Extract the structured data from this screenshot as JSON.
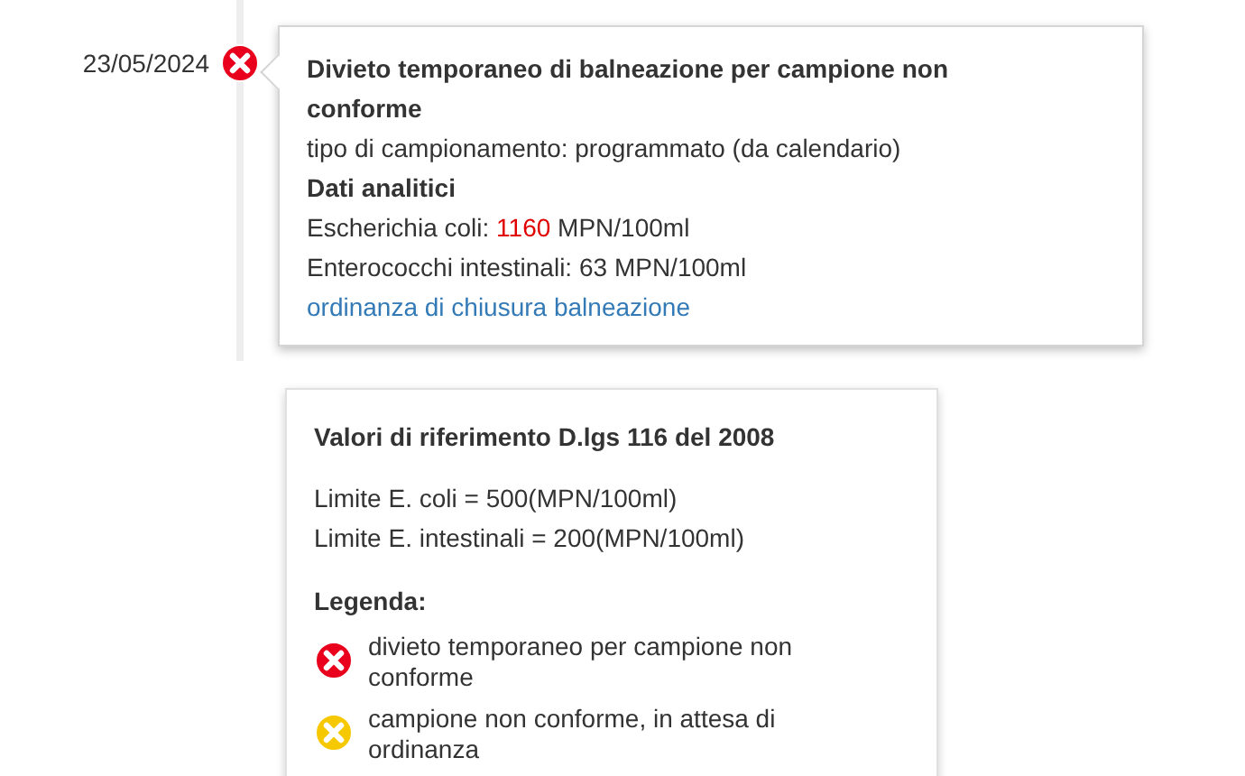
{
  "event": {
    "date": "23/05/2024",
    "color": "#e8001c",
    "title": "Divieto temporaneo di balneazione per campione non conforme",
    "sampling": "tipo di campionamento: programmato (da calendario)",
    "section_title": "Dati analitici",
    "measurements": [
      {
        "label": "Escherichia coli:",
        "value": "1160",
        "unit": "MPN/100ml",
        "exceeds": true
      },
      {
        "label": "Enterococchi intestinali:",
        "value": "63",
        "unit": "MPN/100ml",
        "exceeds": false
      }
    ],
    "link": "ordinanza di chiusura balneazione"
  },
  "reference": {
    "title": "Valori di riferimento D.lgs 116 del 2008",
    "limits": [
      "Limite E. coli = 500(MPN/100ml)",
      "Limite E. intestinali = 200(MPN/100ml)"
    ],
    "legend_title": "Legenda:",
    "legend": [
      {
        "color": "#e8001c",
        "text": "divieto temporaneo per campione non conforme"
      },
      {
        "color": "#f5c800",
        "text": "campione non conforme, in attesa di ordinanza"
      }
    ]
  }
}
